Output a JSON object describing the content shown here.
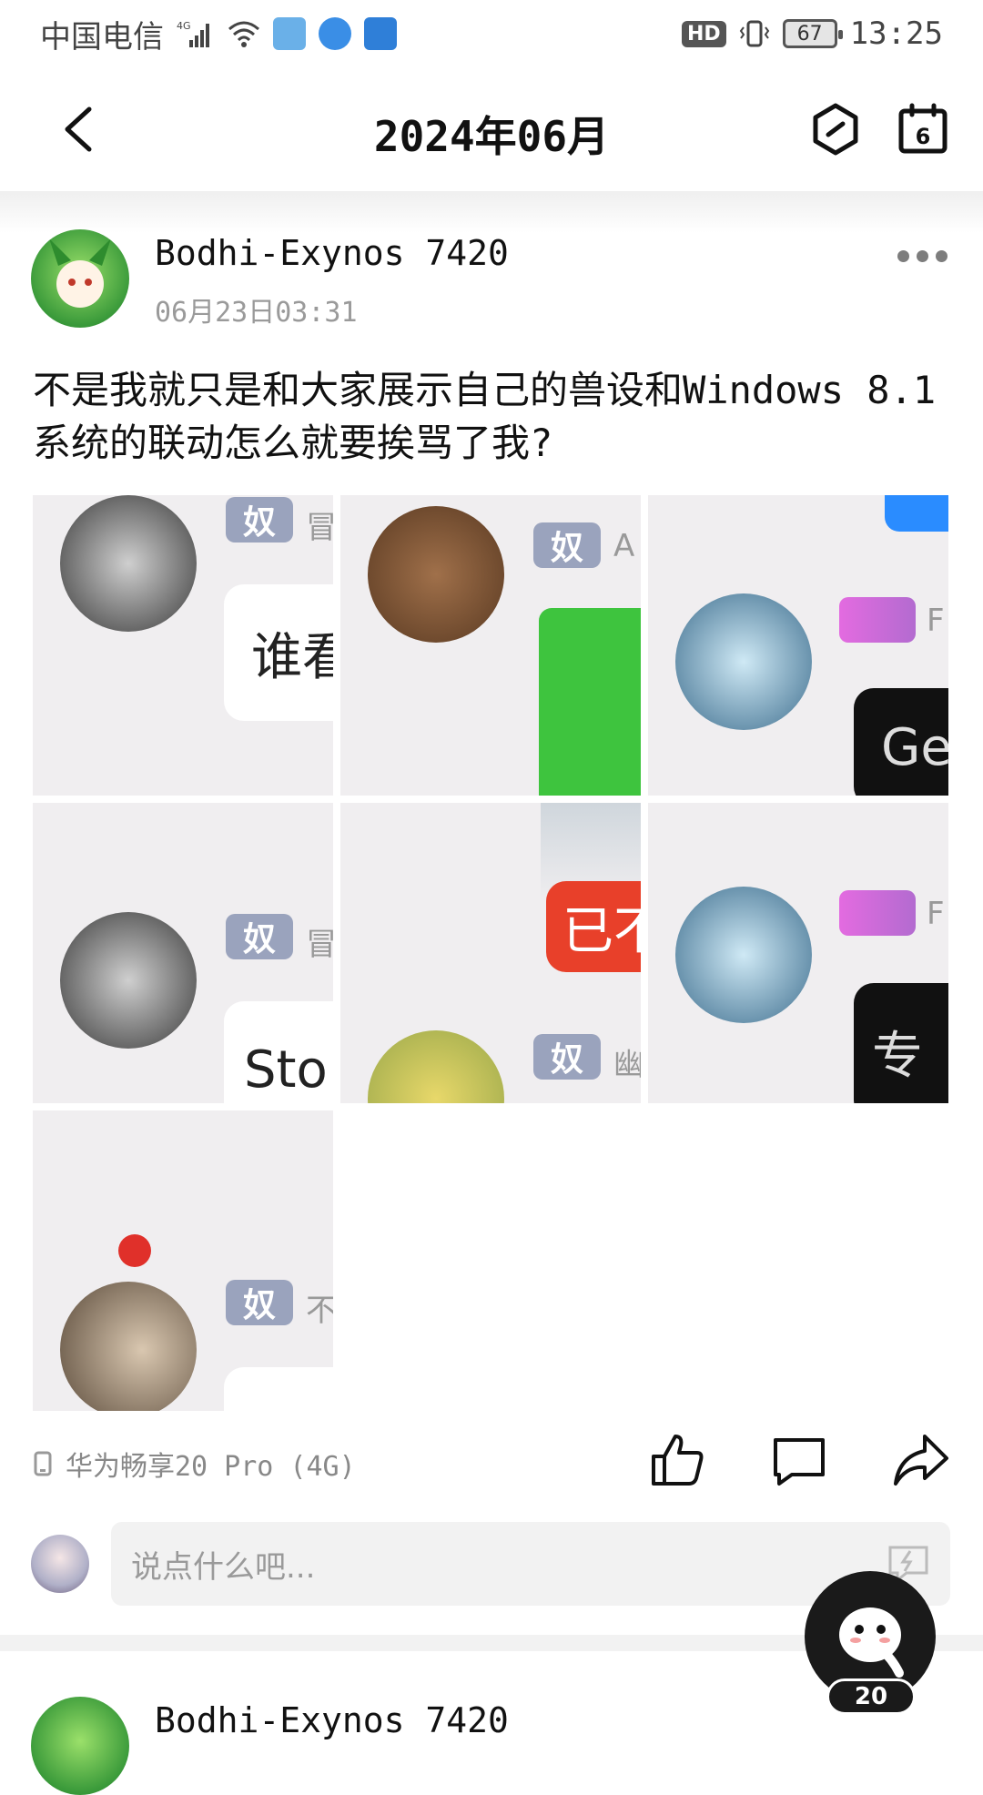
{
  "status_bar": {
    "carrier": "中国电信",
    "network": "4G",
    "hd_label": "HD",
    "battery": "67",
    "time": "13:25"
  },
  "header": {
    "title": "2024年06月"
  },
  "post": {
    "username": "Bodhi-Exynos 7420",
    "time": "06月23日03:31",
    "content": "不是我就只是和大家展示自己的兽设和Windows 8.1系统的联动怎么就要挨骂了我?",
    "images": [
      {
        "tag": "奴",
        "meta": "冒",
        "bubble": "谁看"
      },
      {
        "tag": "奴",
        "meta": "A",
        "bubble": ""
      },
      {
        "tag": "",
        "meta": "F",
        "bubble": "Ge"
      },
      {
        "tag": "奴",
        "meta": "冒",
        "bubble": "Sto"
      },
      {
        "tag": "奴",
        "meta": "幽",
        "bubble": "已不"
      },
      {
        "tag": "",
        "meta": "F",
        "bubble": "专"
      },
      {
        "tag": "奴",
        "meta": "不",
        "bubble": ""
      }
    ],
    "device": "华为畅享20 Pro (4G)"
  },
  "comment": {
    "placeholder": "说点什么吧..."
  },
  "fab": {
    "count": "20"
  },
  "next_post": {
    "username": "Bodhi-Exynos 7420"
  },
  "colors": {
    "tag_bg": "#9aa3bd",
    "cell_bg": "#f0eef0",
    "fab_bg": "#1a1a1a"
  }
}
